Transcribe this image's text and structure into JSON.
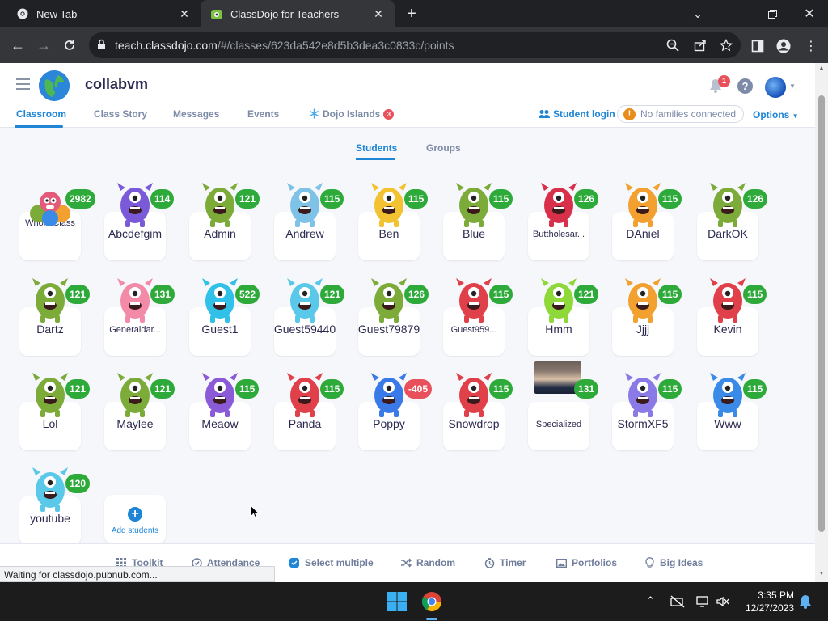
{
  "browser": {
    "tabs": [
      {
        "title": "New Tab",
        "active": false
      },
      {
        "title": "ClassDojo for Teachers",
        "active": true
      }
    ],
    "url_domain": "teach.classdojo.com",
    "url_path": "/#/classes/623da542e8d5b3dea3c0833c/points",
    "status_text": "Waiting for classdojo.pubnub.com..."
  },
  "header": {
    "class_name": "collabvm",
    "notification_count": "1",
    "help_label": "?"
  },
  "nav": {
    "tabs": [
      {
        "label": "Classroom",
        "active": true
      },
      {
        "label": "Class Story",
        "active": false
      },
      {
        "label": "Messages",
        "active": false
      },
      {
        "label": "Events",
        "active": false
      },
      {
        "label": "Dojo Islands",
        "active": false,
        "badge": "3"
      }
    ],
    "student_login": "Student login",
    "families_status": "No families connected",
    "options": "Options"
  },
  "subtabs": {
    "students": "Students",
    "groups": "Groups"
  },
  "students": [
    {
      "name": "Whole Class",
      "points": "2982",
      "color": "#e45a7a",
      "group": true
    },
    {
      "name": "Abcdefgim",
      "points": "114",
      "color": "#7a5ad8"
    },
    {
      "name": "Admin",
      "points": "121",
      "color": "#7dab3a"
    },
    {
      "name": "Andrew",
      "points": "115",
      "color": "#7fc2e8"
    },
    {
      "name": "Ben",
      "points": "115",
      "color": "#f2c230"
    },
    {
      "name": "Blue",
      "points": "115",
      "color": "#7dab3a"
    },
    {
      "name": "Buttholesar...",
      "points": "126",
      "color": "#d8304a"
    },
    {
      "name": "DAniel",
      "points": "115",
      "color": "#f2a030"
    },
    {
      "name": "DarkOK",
      "points": "126",
      "color": "#7dab3a"
    },
    {
      "name": "Dartz",
      "points": "121",
      "color": "#7dab3a"
    },
    {
      "name": "Generaldar...",
      "points": "131",
      "color": "#f28aa8"
    },
    {
      "name": "Guest1",
      "points": "522",
      "color": "#30c0e8"
    },
    {
      "name": "Guest59440",
      "points": "121",
      "color": "#5ac8e8"
    },
    {
      "name": "Guest79879",
      "points": "126",
      "color": "#7dab3a"
    },
    {
      "name": "Guest959...",
      "points": "115",
      "color": "#e0404a"
    },
    {
      "name": "Hmm",
      "points": "121",
      "color": "#8ed83a"
    },
    {
      "name": "Jjjj",
      "points": "115",
      "color": "#f2a030"
    },
    {
      "name": "Kevin",
      "points": "115",
      "color": "#e0404a"
    },
    {
      "name": "Lol",
      "points": "121",
      "color": "#7dab3a"
    },
    {
      "name": "Maylee",
      "points": "121",
      "color": "#7dab3a"
    },
    {
      "name": "Meaow",
      "points": "115",
      "color": "#8a5ad8"
    },
    {
      "name": "Panda",
      "points": "115",
      "color": "#e0404a"
    },
    {
      "name": "Poppy",
      "points": "-405",
      "color": "#3a7ae8",
      "negative": true
    },
    {
      "name": "Snowdrop",
      "points": "115",
      "color": "#e0404a"
    },
    {
      "name": "Specialized",
      "points": "131",
      "color": "#444444",
      "photo": true
    },
    {
      "name": "StormXF5",
      "points": "115",
      "color": "#8a7ae8"
    },
    {
      "name": "Www",
      "points": "115",
      "color": "#3a8ae8"
    },
    {
      "name": "youtube",
      "points": "120",
      "color": "#5ac8e8"
    }
  ],
  "add_students": "Add students",
  "bottom_toolbar": [
    {
      "label": "Toolkit",
      "icon": "grid-icon"
    },
    {
      "label": "Attendance",
      "icon": "clock-check-icon"
    },
    {
      "label": "Select multiple",
      "icon": "checkbox-icon"
    },
    {
      "label": "Random",
      "icon": "shuffle-icon"
    },
    {
      "label": "Timer",
      "icon": "timer-icon"
    },
    {
      "label": "Portfolios",
      "icon": "image-icon"
    },
    {
      "label": "Big Ideas",
      "icon": "lightbulb-icon"
    }
  ],
  "taskbar": {
    "time": "3:35 PM",
    "date": "12/27/2023"
  }
}
